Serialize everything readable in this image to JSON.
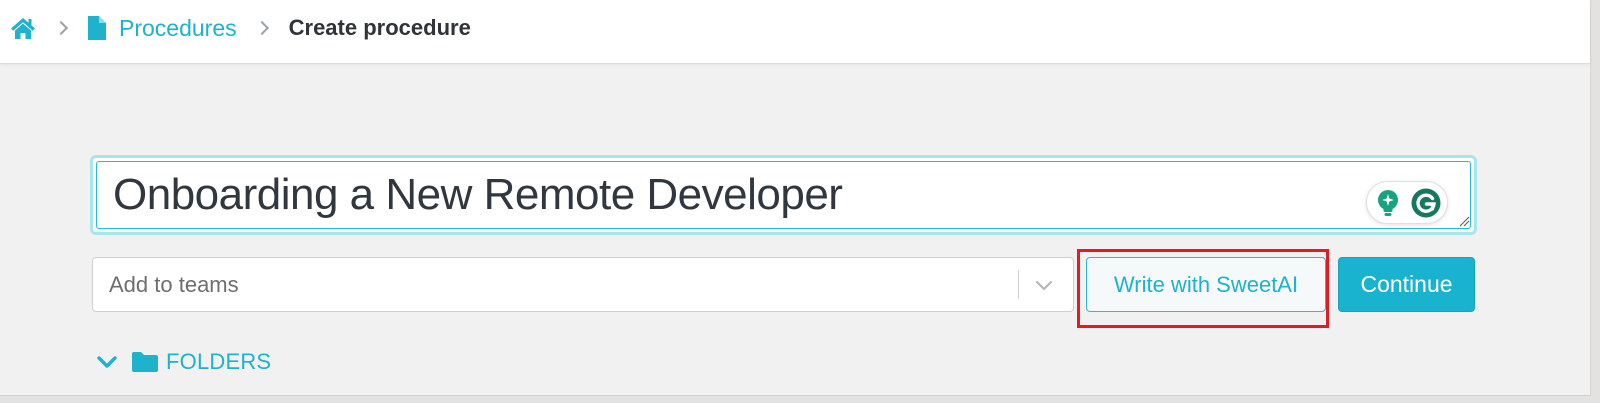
{
  "breadcrumb": {
    "home_icon": "home-icon",
    "items": [
      {
        "label": "Procedures",
        "icon": "document-icon"
      },
      {
        "label": "Create procedure"
      }
    ]
  },
  "title_input": {
    "value": "Onboarding a New Remote Developer"
  },
  "grammarly": {
    "icons": [
      "lightbulb-icon",
      "grammarly-g-icon"
    ]
  },
  "teams_select": {
    "placeholder": "Add to teams"
  },
  "buttons": {
    "sweetai_label": "Write with SweetAI",
    "continue_label": "Continue"
  },
  "folders": {
    "label": "FOLDERS"
  },
  "colors": {
    "accent": "#1fb2cc",
    "primary_button": "#1ab3cf",
    "highlight": "#e01d22",
    "title_text": "#30373e",
    "background": "#f1f1f1"
  }
}
